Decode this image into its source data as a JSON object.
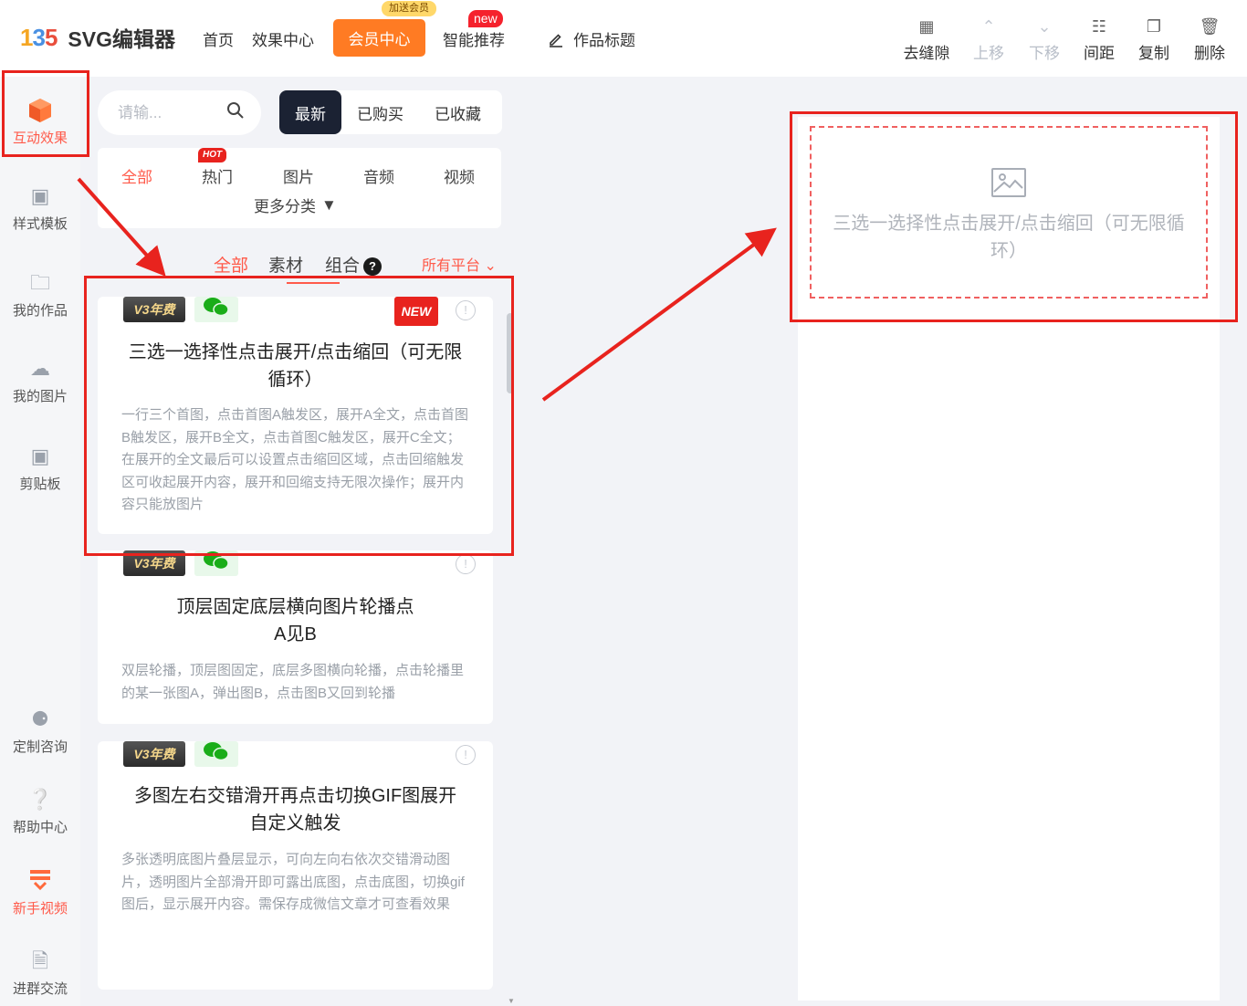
{
  "header": {
    "logo_mark": [
      "1",
      "3",
      "5"
    ],
    "logo_text": "SVG编辑器",
    "nav": [
      "首页",
      "效果中心"
    ],
    "member_btn": "会员中心",
    "member_tag": "加送会员",
    "smart": "智能推荐",
    "new_tag": "new",
    "title": "作品标题",
    "tools": [
      {
        "label": "去缝隙",
        "icon": "gap-icon",
        "enabled": true
      },
      {
        "label": "上移",
        "icon": "move-up-icon",
        "enabled": false
      },
      {
        "label": "下移",
        "icon": "move-down-icon",
        "enabled": false
      },
      {
        "label": "间距",
        "icon": "spacing-icon",
        "enabled": true
      },
      {
        "label": "复制",
        "icon": "copy-icon",
        "enabled": true
      },
      {
        "label": "删除",
        "icon": "delete-icon",
        "enabled": true
      }
    ]
  },
  "sidebar": {
    "items": [
      {
        "label": "互动效果",
        "icon": "cube-icon"
      },
      {
        "label": "样式模板",
        "icon": "template-icon"
      },
      {
        "label": "我的作品",
        "icon": "folder-icon"
      },
      {
        "label": "我的图片",
        "icon": "cloud-upload-icon"
      },
      {
        "label": "剪贴板",
        "icon": "clipboard-icon"
      },
      {
        "label": "定制咨询",
        "icon": "headset-icon"
      },
      {
        "label": "帮助中心",
        "icon": "help-icon"
      },
      {
        "label": "新手视频",
        "icon": "video-icon"
      },
      {
        "label": "进群交流",
        "icon": "document-icon"
      }
    ]
  },
  "panel": {
    "search_placeholder": "请输...",
    "seg": [
      "最新",
      "已购买",
      "已收藏"
    ],
    "categories": [
      "全部",
      "热门",
      "图片",
      "音频",
      "视频"
    ],
    "hot_tag": "HOT",
    "more": "更多分类",
    "subtabs": [
      "全部",
      "素材",
      "组合"
    ],
    "help_mark": "?",
    "platform": "所有平台",
    "badge_v3": "V3年费",
    "badge_new": "NEW",
    "info_mark": "!",
    "cards": [
      {
        "title": "三选一选择性点击展开/点击缩回（可无限循环）",
        "desc": "一行三个首图，点击首图A触发区，展开A全文，点击首图B触发区，展开B全文，点击首图C触发区，展开C全文；在展开的全文最后可以设置点击缩回区域，点击回缩触发区可收起展开内容，展开和回缩支持无限次操作；展开内容只能放图片"
      },
      {
        "title": "顶层固定底层横向图片轮播点A见B",
        "desc": "双层轮播，顶层图固定，底层多图横向轮播，点击轮播里的某一张图A，弹出图B，点击图B又回到轮播"
      },
      {
        "title": "多图左右交错滑开再点击切换GIF图展开自定义触发",
        "desc": "多张透明底图片叠层显示，可向左向右依次交错滑动图片，透明图片全部滑开即可露出底图，点击底图，切换gif图后，显示展开内容。需保存成微信文章才可查看效果"
      }
    ]
  },
  "canvas": {
    "placeholder_text": "三选一选择性点击展开/点击缩回（可无限循环）"
  },
  "colors": {
    "accent": "#ff5a4a",
    "member": "#ff7b23",
    "annotation": "#e8231e",
    "dark": "#1b2233"
  }
}
